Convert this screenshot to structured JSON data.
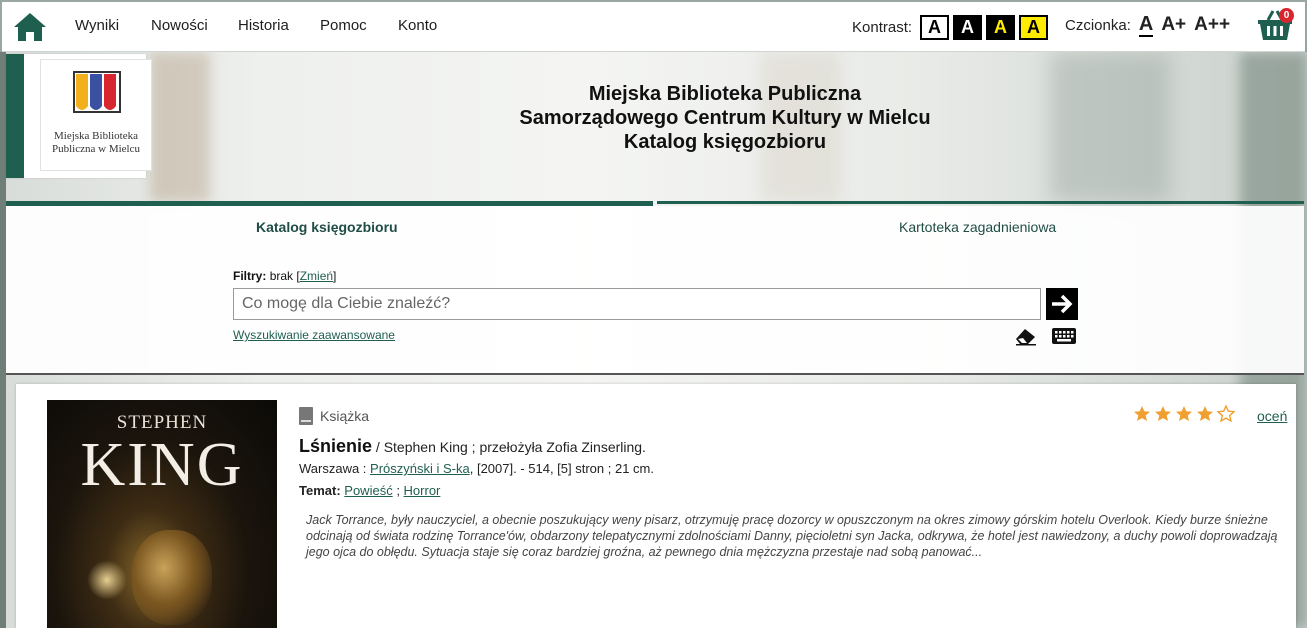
{
  "nav": {
    "items": [
      "Wyniki",
      "Nowości",
      "Historia",
      "Pomoc",
      "Konto"
    ]
  },
  "contrast": {
    "label": "Kontrast:",
    "options": [
      "A",
      "A",
      "A",
      "A"
    ]
  },
  "font_size": {
    "label": "Czcionka:",
    "options": [
      "A",
      "A+",
      "A++"
    ]
  },
  "cart": {
    "count": "0"
  },
  "header": {
    "logo_text": [
      "Miejska Biblioteka",
      "Publiczna w Mielcu"
    ],
    "title_lines": [
      "Miejska Biblioteka Publiczna",
      "Samorządowego Centrum Kultury w Mielcu",
      "Katalog księgozbioru"
    ]
  },
  "tabs": [
    "Katalog księgozbioru",
    "Kartoteka zagadnieniowa"
  ],
  "search": {
    "filters_label": "Filtry:",
    "filters_value": "brak",
    "filters_change": "Zmień",
    "placeholder": "Co mogę dla Ciebie znaleźć?",
    "advanced": "Wyszukiwanie zaawansowane"
  },
  "result": {
    "cover_author": "STEPHEN",
    "cover_name": "KING",
    "type": "Książka",
    "title": "Lśnienie",
    "responsibility": " / Stephen King ; przełożyła Zofia Zinserling.",
    "pub_place": "Warszawa : ",
    "publisher": "Prószyński i S-ka",
    "pub_rest": ", [2007]. - 514, [5] stron ; 21 cm.",
    "subject_label": "Temat:",
    "subjects": [
      "Powieść",
      "Horror"
    ],
    "subject_sep": " ; ",
    "description": "Jack Torrance, były nauczyciel, a obecnie poszukujący weny pisarz, otrzymuję pracę dozorcy w opuszczonym na okres zimowy górskim hotelu Overlook. Kiedy burze śnieżne odcinają od świata rodzinę Torrance'ów, obdarzony telepatycznymi zdolnościami Danny, pięcioletni syn Jacka, odkrywa, że hotel jest nawiedzony, a duchy powoli doprowadzają jego ojca do obłędu. Sytuacja staje się coraz bardziej groźna, aż pewnego dnia mężczyzna przestaje nad sobą panować...",
    "rating": 4,
    "rating_max": 5,
    "rate_label": "oceń"
  },
  "colors": {
    "accent": "#1f5f50",
    "star": "#f0a030",
    "badge": "#d8262e"
  }
}
